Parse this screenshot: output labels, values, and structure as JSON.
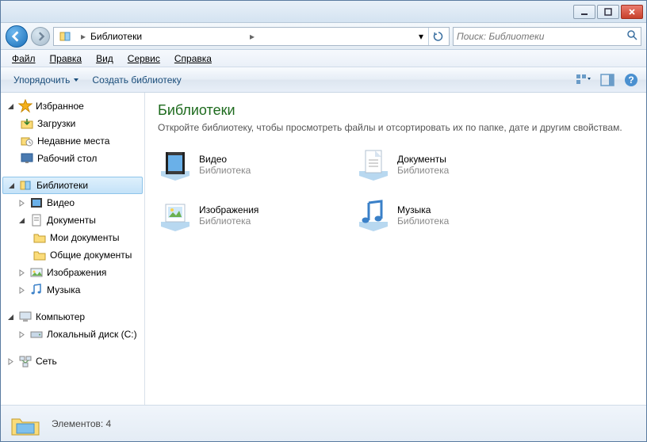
{
  "window": {
    "minimize": "_",
    "maximize": "□",
    "close": "×"
  },
  "nav": {
    "breadcrumb_root": "Библиотеки",
    "search_placeholder": "Поиск: Библиотеки"
  },
  "menu": {
    "file": "Файл",
    "edit": "Правка",
    "view": "Вид",
    "tools": "Сервис",
    "help": "Справка"
  },
  "toolbar": {
    "organize": "Упорядочить",
    "new_library": "Создать библиотеку"
  },
  "sidebar": {
    "favorites": {
      "label": "Избранное",
      "items": [
        "Загрузки",
        "Недавние места",
        "Рабочий стол"
      ]
    },
    "libraries": {
      "label": "Библиотеки",
      "items": [
        {
          "label": "Видео"
        },
        {
          "label": "Документы",
          "children": [
            "Мои документы",
            "Общие документы"
          ]
        },
        {
          "label": "Изображения"
        },
        {
          "label": "Музыка"
        }
      ]
    },
    "computer": {
      "label": "Компьютер",
      "items": [
        "Локальный диск (C:)"
      ]
    },
    "network": {
      "label": "Сеть"
    }
  },
  "content": {
    "title": "Библиотеки",
    "description": "Откройте библиотеку, чтобы просмотреть файлы и отсортировать их по папке, дате и другим свойствам.",
    "items": [
      {
        "name": "Видео",
        "sub": "Библиотека"
      },
      {
        "name": "Документы",
        "sub": "Библиотека"
      },
      {
        "name": "Изображения",
        "sub": "Библиотека"
      },
      {
        "name": "Музыка",
        "sub": "Библиотека"
      }
    ]
  },
  "status": {
    "text": "Элементов: 4"
  }
}
